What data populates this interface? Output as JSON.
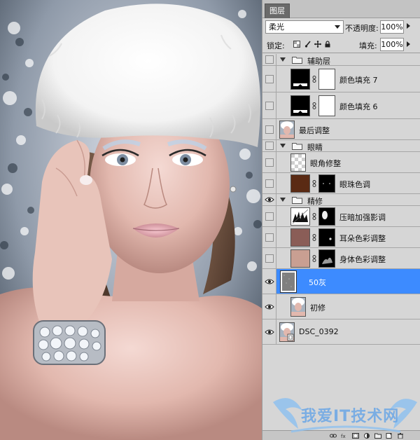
{
  "panel": {
    "tab_label": "图层",
    "blend_mode": "柔光",
    "opacity_label": "不透明度:",
    "opacity_value": "100%",
    "lock_label": "锁定:",
    "fill_label": "填充:",
    "fill_value": "100%"
  },
  "layers": [
    {
      "kind": "group",
      "name": "辅助层",
      "visible": false
    },
    {
      "kind": "fill",
      "name": "颜色填充 7",
      "visible": false
    },
    {
      "kind": "fill",
      "name": "颜色填充 6",
      "visible": false
    },
    {
      "kind": "photo",
      "name": "最后调整",
      "visible": false
    },
    {
      "kind": "group",
      "name": "眼睛",
      "visible": false
    },
    {
      "kind": "transparent",
      "name": "眼角修整",
      "visible": false
    },
    {
      "kind": "brown-mask",
      "name": "眼珠色调",
      "visible": false
    },
    {
      "kind": "group",
      "name": "精修",
      "visible": true
    },
    {
      "kind": "curves-mask",
      "name": "压暗加强影调",
      "visible": false
    },
    {
      "kind": "mauve-mask",
      "name": "耳朵色彩调整",
      "visible": false
    },
    {
      "kind": "skin-mask",
      "name": "身体色彩调整",
      "visible": false
    },
    {
      "kind": "gray",
      "name": "50灰",
      "visible": true,
      "selected": true
    },
    {
      "kind": "photo",
      "name": "初修",
      "visible": true
    },
    {
      "kind": "photo-smart",
      "name": "DSC_0392",
      "visible": true
    }
  ],
  "watermark": {
    "text": "我爱IT技术网"
  },
  "colors": {
    "selection": "#3d8bff",
    "panel_bg": "#d6d6d6",
    "brown_fill": "#5a2a14",
    "mauve_fill": "#8a5d57",
    "skin_fill": "#c99f92"
  }
}
